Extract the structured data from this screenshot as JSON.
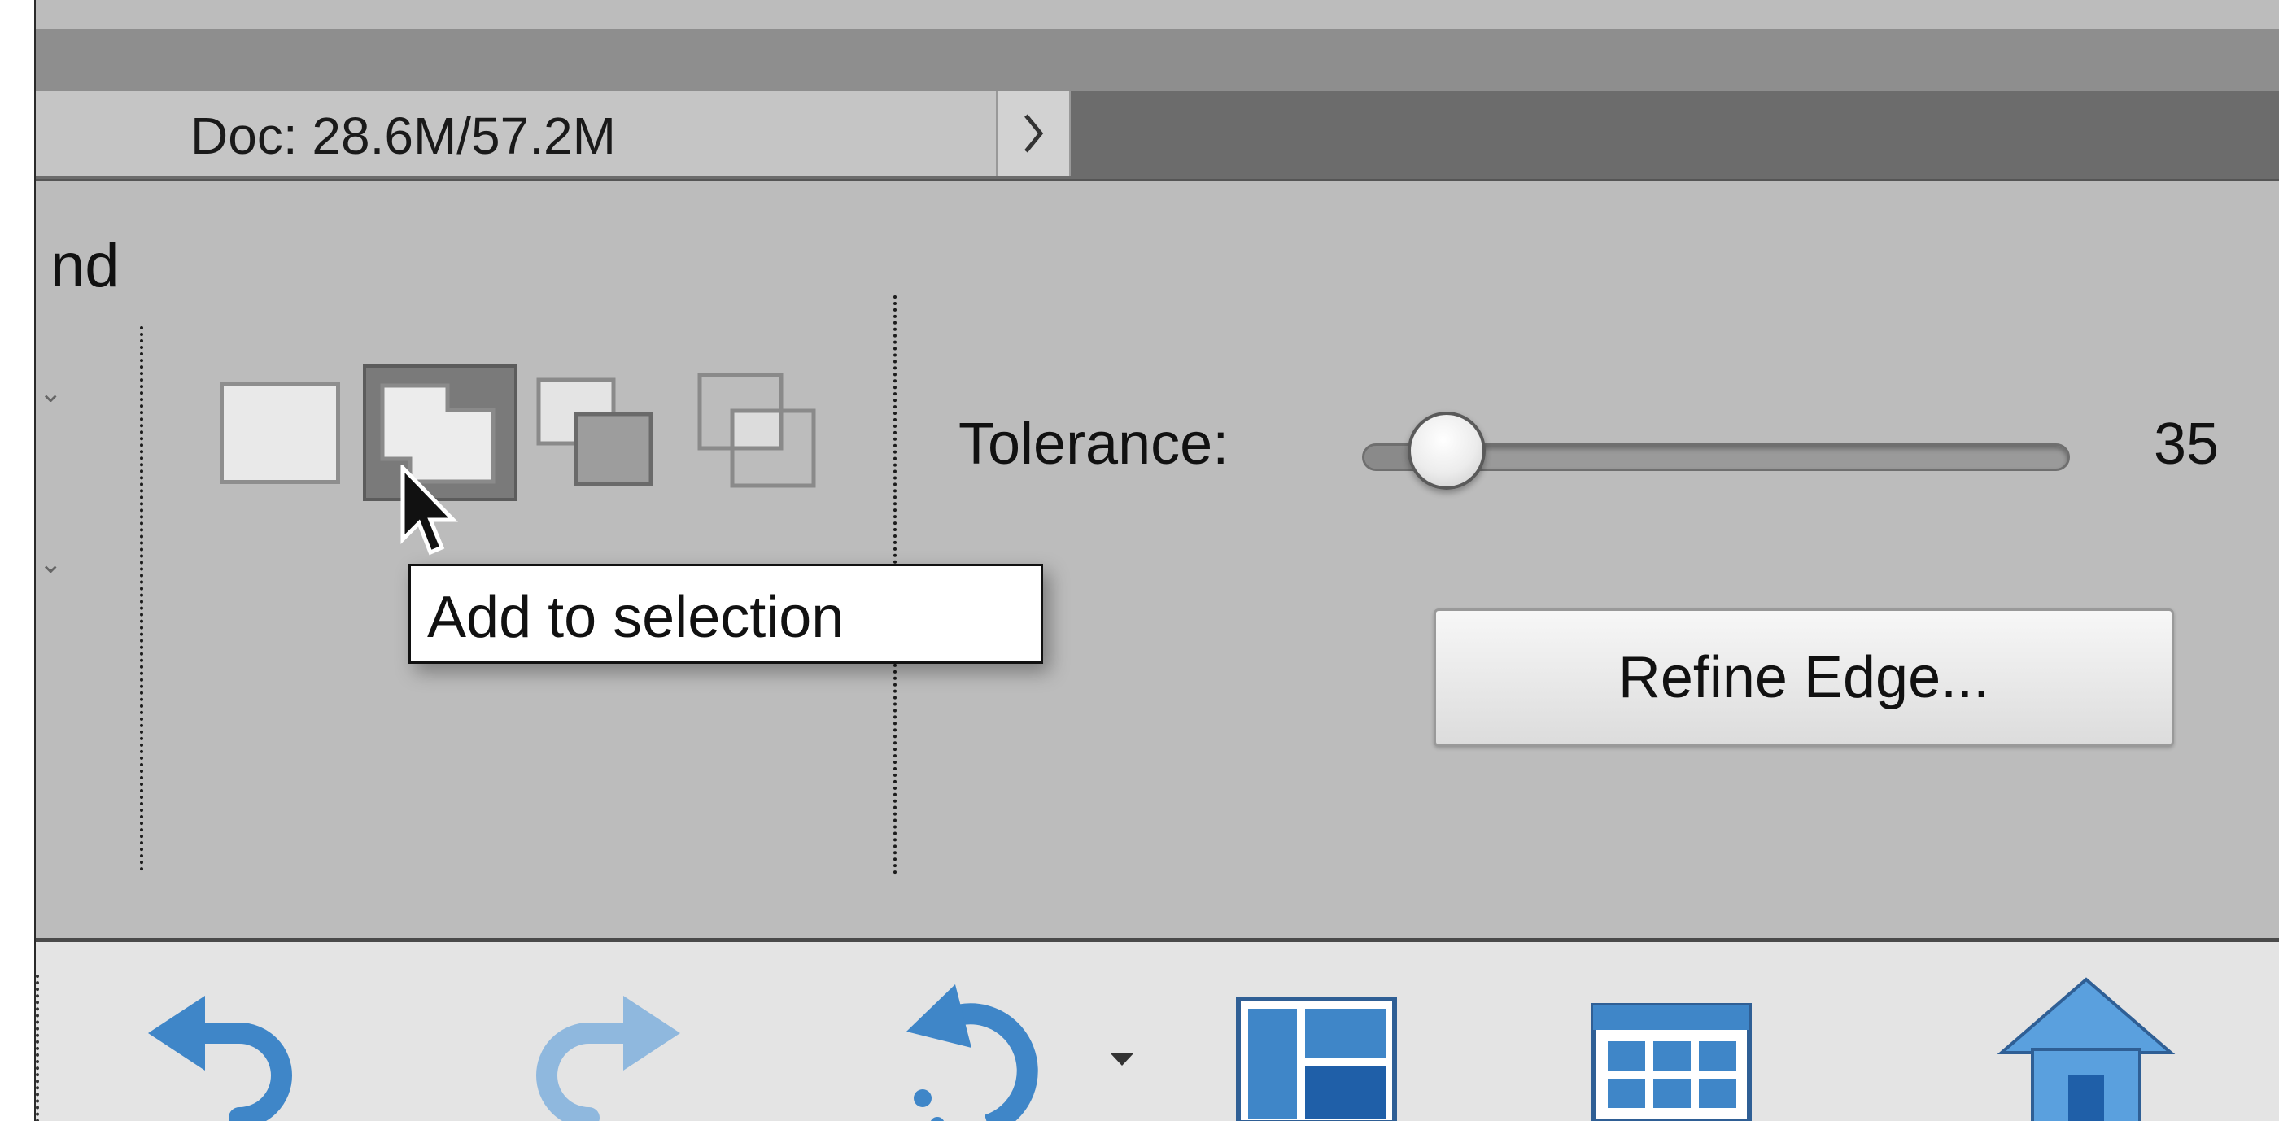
{
  "status_bar": {
    "doc_info": "Doc: 28.6M/57.2M",
    "expand_icon": "chevron-right-icon"
  },
  "options_bar": {
    "partial_label": "nd",
    "selection_modes": [
      {
        "name": "new-selection",
        "icon": "new-selection-icon"
      },
      {
        "name": "add-to-selection",
        "icon": "add-to-selection-icon",
        "active": true
      },
      {
        "name": "subtract-from-selection",
        "icon": "subtract-from-selection-icon"
      },
      {
        "name": "intersect-with-selection",
        "icon": "intersect-with-selection-icon"
      }
    ],
    "tooltip": "Add to selection",
    "tolerance": {
      "label": "Tolerance:",
      "value": "35",
      "slider_fraction": 0.12
    },
    "refine_button": "Refine Edge..."
  },
  "taskbar": {
    "buttons": [
      {
        "icon": "undo-icon"
      },
      {
        "icon": "redo-icon"
      },
      {
        "icon": "rotate-icon"
      },
      {
        "icon": "layout-icon"
      },
      {
        "icon": "organizer-grid-icon"
      },
      {
        "icon": "home-icon"
      }
    ]
  },
  "colors": {
    "panel_bg": "#bcbcbc",
    "status_bar_bg": "#6c6c6c",
    "icon_blue": "#3f86c8"
  }
}
